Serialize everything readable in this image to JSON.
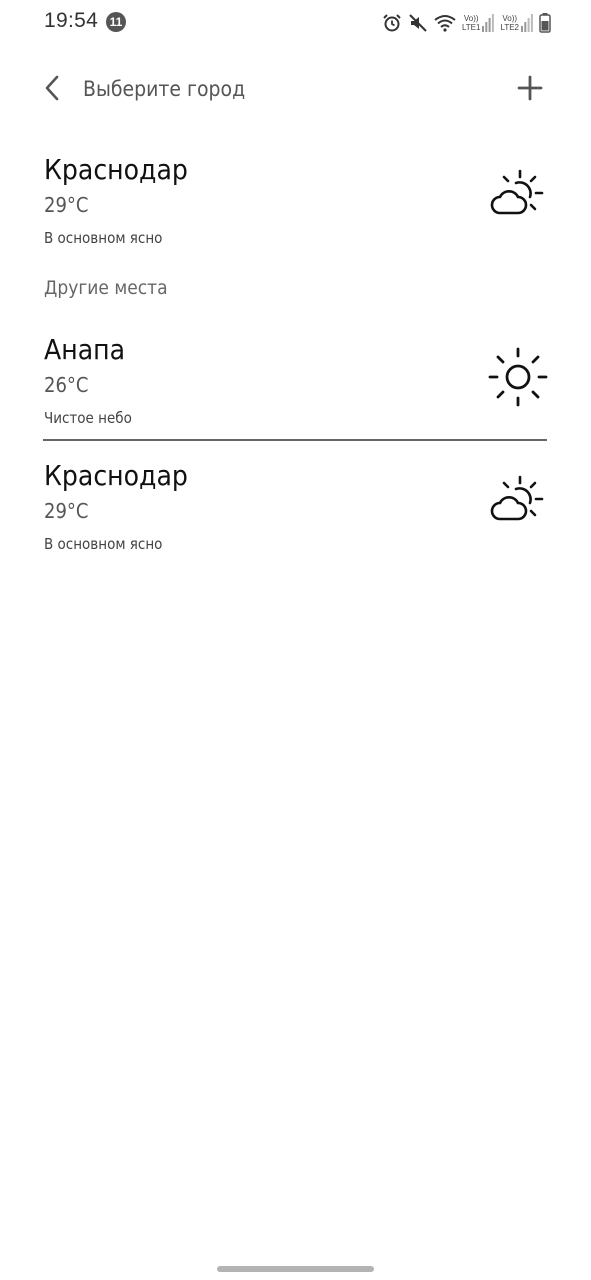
{
  "status_bar": {
    "time": "19:54",
    "notification_count": "11",
    "sim1_label_top": "Vo))",
    "sim1_label_bottom": "LTE1",
    "sim2_label_top": "Vo))",
    "sim2_label_bottom": "LTE2",
    "icons": [
      "alarm-icon",
      "mute-icon",
      "wifi-icon",
      "signal-icon",
      "signal-icon",
      "battery-icon"
    ]
  },
  "header": {
    "title": "Выберите город",
    "back_icon": "chevron-left-icon",
    "add_icon": "plus-icon"
  },
  "current_city": {
    "name": "Краснодар",
    "temp": "29°C",
    "condition": "В основном ясно",
    "icon": "partly-sunny-icon"
  },
  "other_places_label": "Другие места",
  "other_places": [
    {
      "name": "Анапа",
      "temp": "26°C",
      "condition": "Чистое небо",
      "icon": "sunny-icon"
    },
    {
      "name": "Краснодар",
      "temp": "29°C",
      "condition": "В основном ясно",
      "icon": "partly-sunny-icon"
    }
  ]
}
